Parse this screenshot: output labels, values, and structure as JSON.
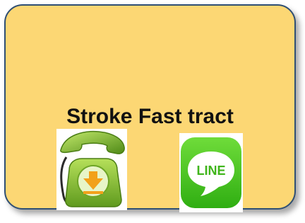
{
  "title": "Stroke Fast tract",
  "icons": {
    "phone": "phone-download-icon",
    "line": "line-app-icon",
    "line_logo_text": "LINE"
  },
  "colors": {
    "card_background": "#fcd774",
    "card_border": "#2f4f74",
    "phone_green": "#7cb82f",
    "line_green": "#46c21a"
  }
}
